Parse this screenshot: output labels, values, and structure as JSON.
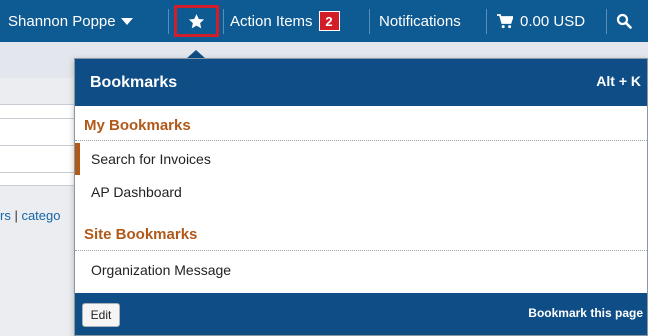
{
  "topbar": {
    "user_name": "Shannon Poppe",
    "action_items_label": "Action Items",
    "action_items_count": "2",
    "notifications_label": "Notifications",
    "cart_total": "0.00 USD"
  },
  "background": {
    "links_left": "rs",
    "links_sep": " | ",
    "links_right": "catego"
  },
  "bookmarks": {
    "title": "Bookmarks",
    "shortcut": "Alt + K",
    "my_section_title": "My Bookmarks",
    "my_items": [
      {
        "label": "Search for Invoices"
      },
      {
        "label": "AP Dashboard"
      }
    ],
    "site_section_title": "Site Bookmarks",
    "site_items": [
      {
        "label": "Organization Message"
      }
    ],
    "edit_label": "Edit",
    "bookmark_page_label": "Bookmark this page"
  },
  "colors": {
    "topbar_bg": "#0e5a93",
    "dropdown_header_bg": "#0e4d85",
    "section_title": "#b05a1a",
    "badge_bg": "#d21e26",
    "highlight_border": "#d01e2a"
  },
  "icons": {
    "user_menu": "chevron-down-icon",
    "bookmarks": "star-icon",
    "cart": "cart-icon",
    "search": "search-icon"
  }
}
